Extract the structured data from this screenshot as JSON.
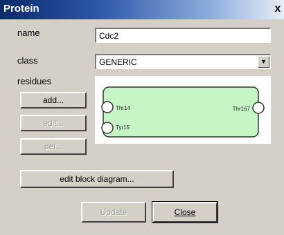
{
  "window": {
    "title": "Protein",
    "close_glyph": "x"
  },
  "form": {
    "name_label": "name",
    "name_value": "Cdc2",
    "class_label": "class",
    "class_value": "GENERIC",
    "residues_label": "residues"
  },
  "buttons": {
    "add": "add...",
    "edit": "edit...",
    "del": "del...",
    "edit_block_diagram": "edit block diagram...",
    "update": "Update",
    "close": "Close"
  },
  "diagram": {
    "fill_color": "#c6f5c6",
    "residues": [
      {
        "label": "Thr14"
      },
      {
        "label": "Tyr15"
      },
      {
        "label": "Thr167"
      }
    ]
  },
  "icons": {
    "select_arrow": "chevron-down-icon"
  }
}
